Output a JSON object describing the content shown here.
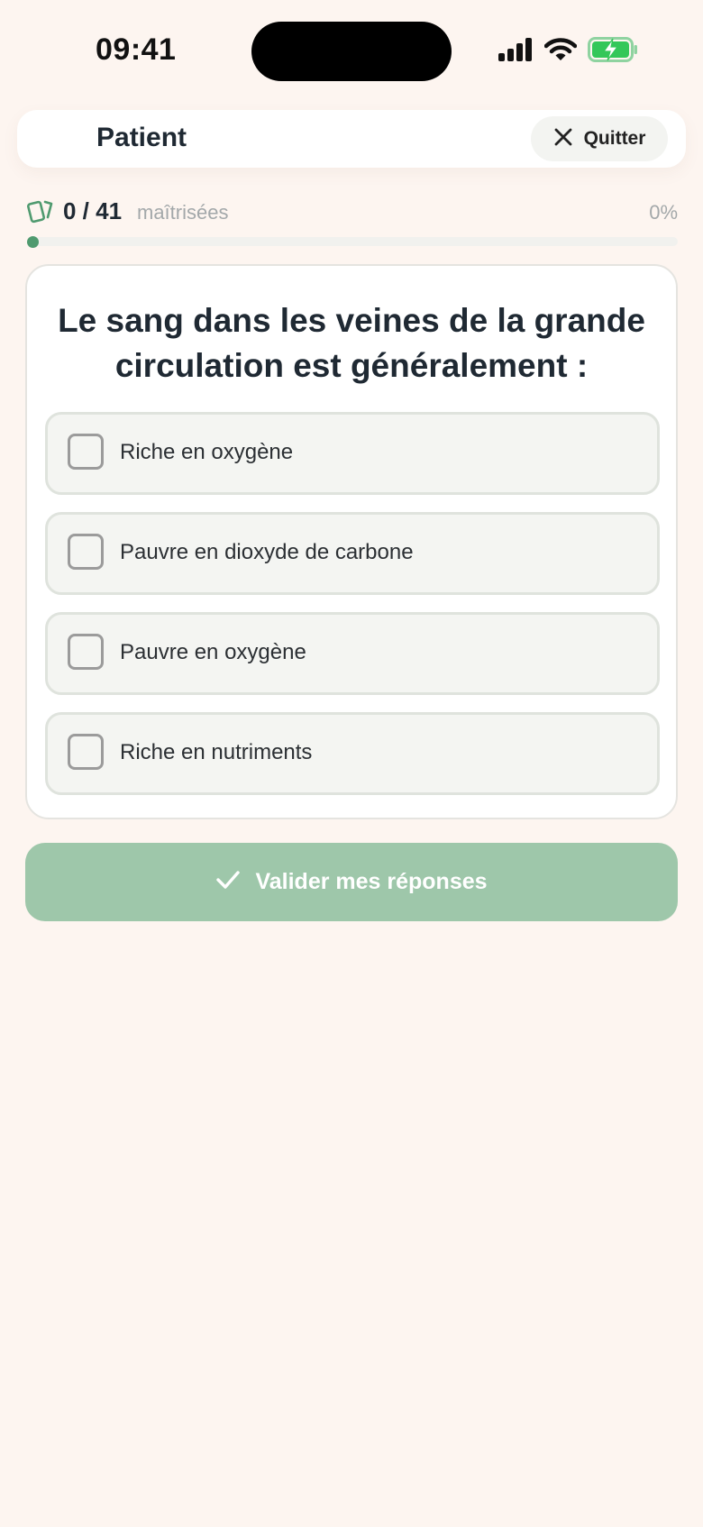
{
  "status_bar": {
    "time": "09:41",
    "icons": [
      "signal-icon",
      "wifi-icon",
      "battery-charging-icon"
    ]
  },
  "header": {
    "title": "Patient",
    "quit_label": "Quitter"
  },
  "progress": {
    "count": "0 / 41",
    "mastered_label": "maîtrisées",
    "percent_label": "0%",
    "value": 0
  },
  "quiz": {
    "question": "Le sang dans les veines de la grande circulation est généralement :",
    "options": [
      {
        "label": "Riche en oxygène",
        "checked": false
      },
      {
        "label": "Pauvre en dioxyde de carbone",
        "checked": false
      },
      {
        "label": "Pauvre en oxygène",
        "checked": false
      },
      {
        "label": "Riche en nutriments",
        "checked": false
      }
    ]
  },
  "actions": {
    "validate_label": "Valider mes réponses"
  },
  "colors": {
    "background": "#fdf5f0",
    "accent_green": "#4f9a6f",
    "button_green_disabled": "#9ec7aa",
    "battery_green": "#34c759"
  }
}
